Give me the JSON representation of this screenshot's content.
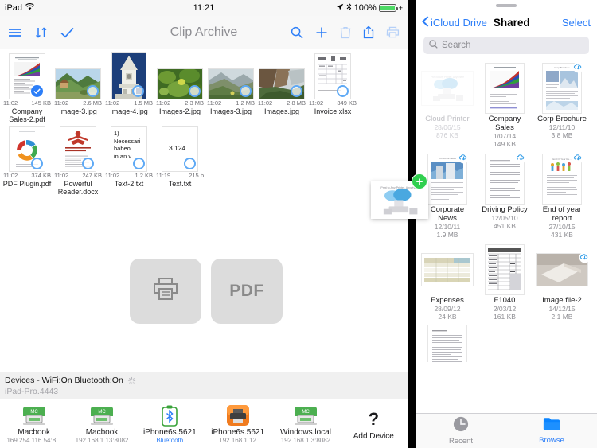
{
  "status_bar": {
    "device": "iPad",
    "wifi_icon": "wifi-icon",
    "time": "11:21",
    "location_icon": "location-arrow-icon",
    "bluetooth_icon": "bluetooth-icon",
    "battery_percent": "100%",
    "battery_icon": "battery-full-icon"
  },
  "left_pane": {
    "navbar": {
      "menu_icon": "hamburger-menu-icon",
      "sort_icon": "sort-arrows-icon",
      "select_icon": "checkmark-icon",
      "title": "Clip Archive",
      "search_icon": "search-icon",
      "add_icon": "plus-icon",
      "delete_icon": "trash-icon",
      "share_icon": "share-icon",
      "print_icon": "printer-icon"
    },
    "files": [
      {
        "name": "Company Sales-2.pdf",
        "time": "11:02",
        "size": "145 KB",
        "kind": "chart-doc",
        "checked": true
      },
      {
        "name": "Image-3.jpg",
        "time": "11:02",
        "size": "2.6 MB",
        "kind": "photo-hills",
        "checked": false
      },
      {
        "name": "Image-4.jpg",
        "time": "11:02",
        "size": "1.5 MB",
        "kind": "photo-tower",
        "checked": false
      },
      {
        "name": "Images-2.jpg",
        "time": "11:02",
        "size": "2.3 MB",
        "kind": "photo-leaves",
        "checked": false
      },
      {
        "name": "Images-3.jpg",
        "time": "11:02",
        "size": "1.2 MB",
        "kind": "photo-valley",
        "checked": false
      },
      {
        "name": "Images.jpg",
        "time": "11:02",
        "size": "2.8 MB",
        "kind": "photo-coast",
        "checked": false
      },
      {
        "name": "Invoice.xlsx",
        "time": "11:02",
        "size": "349 KB",
        "kind": "spreadsheet",
        "checked": false
      },
      {
        "name": "PDF Plugin.pdf",
        "time": "11:02",
        "size": "374 KB",
        "kind": "cycle-doc",
        "checked": false
      },
      {
        "name": "Powerful Reader.docx",
        "time": "11:02",
        "size": "247 KB",
        "kind": "red-doc",
        "checked": false
      },
      {
        "name": "Text-2.txt",
        "time": "11:02",
        "size": "1.2 KB",
        "kind": "text-latin",
        "checked": false,
        "preview": [
          "1)",
          "Necessari",
          " habeo",
          "in an v"
        ]
      },
      {
        "name": "Text.txt",
        "time": "11:19",
        "size": "215 b",
        "kind": "text-number",
        "checked": false,
        "preview": [
          "3.124"
        ]
      }
    ],
    "drop_targets": [
      {
        "label": "",
        "icon": "printer-icon",
        "name": "print-drop-target"
      },
      {
        "label": "PDF",
        "icon": "",
        "name": "pdf-drop-target"
      }
    ],
    "devices_header": {
      "title": "Devices - WiFi:On  Bluetooth:On",
      "spinner_icon": "loading-spinner-icon",
      "hostname": "iPad-Pro.4443"
    },
    "devices": [
      {
        "name": "Macbook",
        "address": "169.254.116.54:8...",
        "icon": "mac-printer-icon",
        "blue": false
      },
      {
        "name": "Macbook",
        "address": "192.168.1.13:8082",
        "icon": "mac-printer-icon",
        "blue": false
      },
      {
        "name": "iPhone6s.5621",
        "address": "Bluetooth",
        "icon": "bluetooth-device-icon",
        "blue": true
      },
      {
        "name": "iPhone6s.5621",
        "address": "192.168.1.12",
        "icon": "orange-printer-icon",
        "blue": false
      },
      {
        "name": "Windows.local",
        "address": "192.168.1.3:8082",
        "icon": "mac-printer-icon",
        "blue": false
      },
      {
        "name": "Add Device",
        "address": "",
        "icon": "question-mark-icon",
        "blue": false
      }
    ]
  },
  "right_pane": {
    "back_label": "iCloud Drive",
    "back_icon": "chevron-left-icon",
    "title": "Shared",
    "select_label": "Select",
    "search": {
      "placeholder": "Search",
      "icon": "search-icon"
    },
    "files": [
      {
        "name": "Cloud Printer",
        "date": "28/06/15",
        "size": "876 KB",
        "kind": "cloud-printer",
        "dimmed": true,
        "cloud": false
      },
      {
        "name": "Company Sales",
        "date": "1/07/14",
        "size": "149 KB",
        "kind": "chart-doc",
        "dimmed": false,
        "cloud": false
      },
      {
        "name": "Corp Brochure",
        "date": "12/11/10",
        "size": "3.8 MB",
        "kind": "brochure",
        "dimmed": false,
        "cloud": true
      },
      {
        "name": "Corporate News",
        "date": "12/10/11",
        "size": "1.9 MB",
        "kind": "news",
        "dimmed": false,
        "cloud": true
      },
      {
        "name": "Driving Policy",
        "date": "12/05/10",
        "size": "451 KB",
        "kind": "text-doc",
        "dimmed": false,
        "cloud": true
      },
      {
        "name": "End of year report",
        "date": "27/10/15",
        "size": "431 KB",
        "kind": "report",
        "dimmed": false,
        "cloud": true
      },
      {
        "name": "Expenses",
        "date": "28/09/12",
        "size": "24 KB",
        "kind": "expense-sheet",
        "dimmed": false,
        "cloud": false
      },
      {
        "name": "F1040",
        "date": "2/03/12",
        "size": "161 KB",
        "kind": "tax-form",
        "dimmed": false,
        "cloud": false
      },
      {
        "name": "Image file-2",
        "date": "14/12/15",
        "size": "2.1 MB",
        "kind": "photo-box",
        "dimmed": false,
        "cloud": true
      }
    ],
    "partial_file": {
      "kind": "letter-doc"
    },
    "tabs": [
      {
        "label": "Recent",
        "icon": "clock-icon",
        "active": false
      },
      {
        "label": "Browse",
        "icon": "folder-icon",
        "active": true
      }
    ]
  },
  "drag": {
    "item_name": "Cloud Printer",
    "badge": "+",
    "badge_icon": "add-green-badge-icon",
    "accent": "#30cf4f"
  },
  "colors": {
    "accent_blue": "#2c7ef8",
    "green": "#30cf4f",
    "grey_text": "#8e8e93",
    "drop_bg": "#dcdcdc"
  }
}
